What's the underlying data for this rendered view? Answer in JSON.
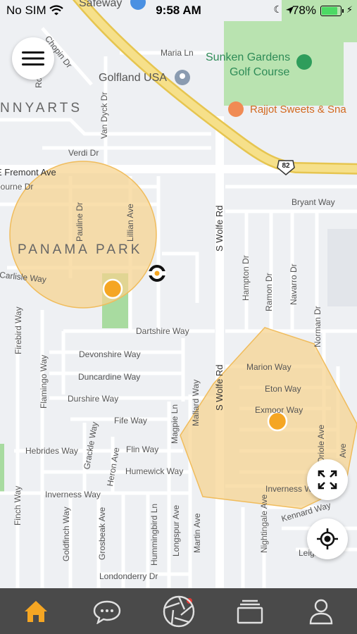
{
  "status_bar": {
    "carrier": "No SIM",
    "time": "9:58 AM",
    "battery_percent": "78%",
    "battery_level": 0.78
  },
  "map": {
    "area_labels": {
      "nnyarts": "NNYARTS",
      "panama_park": "PANAMA PARK"
    },
    "pois": {
      "safeway": "Safeway",
      "golfland": "Golfland USA",
      "sunken_gardens_line1": "Sunken Gardens",
      "sunken_gardens_line2": "Golf Course",
      "rajjot": "Rajjot Sweets & Sna"
    },
    "highway_shield": "82",
    "streets": {
      "chopin": "Chopin Dr",
      "maria": "Maria Ln",
      "van_dyck": "Van Dyck Dr",
      "verdi": "Verdi Dr",
      "e_fremont": "E Fremont Ave",
      "bourne": "bourne Dr",
      "pauline": "Pauline Dr",
      "lillian": "Lillian Ave",
      "bryant": "Bryant Way",
      "s_wolfe_upper": "S Wolfe Rd",
      "carlisle": "Carlisle Way",
      "hampton": "Hampton Dr",
      "ramon": "Ramon Dr",
      "navarro": "Navarro Dr",
      "firebird": "Firebird Way",
      "dartshire": "Dartshire Way",
      "norman": "Norman Dr",
      "devonshire": "Devonshire Way",
      "marion": "Marion Way",
      "flamingo": "Flamingo Way",
      "duncardine": "Duncardine Way",
      "s_wolfe_lower": "S Wolfe Rd",
      "eton": "Eton Way",
      "durshire": "Durshire Way",
      "mallard": "Mallard Way",
      "exmoor": "Exmoor Way",
      "fife": "Fife Way",
      "magpie": "Magpie Ln",
      "grackle": "Grackle Way",
      "oriole": "Oriole Ave",
      "hebrides": "Hebrides Way",
      "flin": "Flin Way",
      "heron": "Heron Ave",
      "humewick": "Humewick Way",
      "inverness_left": "Inverness Way",
      "inverness_right": "Inverness W",
      "finch": "Finch Way",
      "goldfinch": "Goldfinch Way",
      "grosbeak": "Grosbeak Ave",
      "hummingbird": "Hummingbird Ln",
      "longspur": "Longspur Ave",
      "martin": "Martin Ave",
      "nightingale": "Nightingale Ave",
      "kennard": "Kennard Way",
      "leigh": "Leigh",
      "londonderry": "Londonderry Dr",
      "ro": "Ro",
      "ave_edge": "Ave"
    }
  },
  "colors": {
    "zone_fill": "#f7d28d",
    "zone_marker": "#f5a623",
    "highway": "#f3d86b",
    "tabbar": "#4a4a4a",
    "active_tab": "#f5a623",
    "park_green": "#a8dba0"
  },
  "tabs": [
    {
      "name": "home",
      "icon": "home-icon",
      "active": true
    },
    {
      "name": "messages",
      "icon": "chat-bubble-icon",
      "badge": true
    },
    {
      "name": "camera",
      "icon": "camera-shutter-icon"
    },
    {
      "name": "collection",
      "icon": "stack-icon"
    },
    {
      "name": "profile",
      "icon": "user-icon"
    }
  ]
}
